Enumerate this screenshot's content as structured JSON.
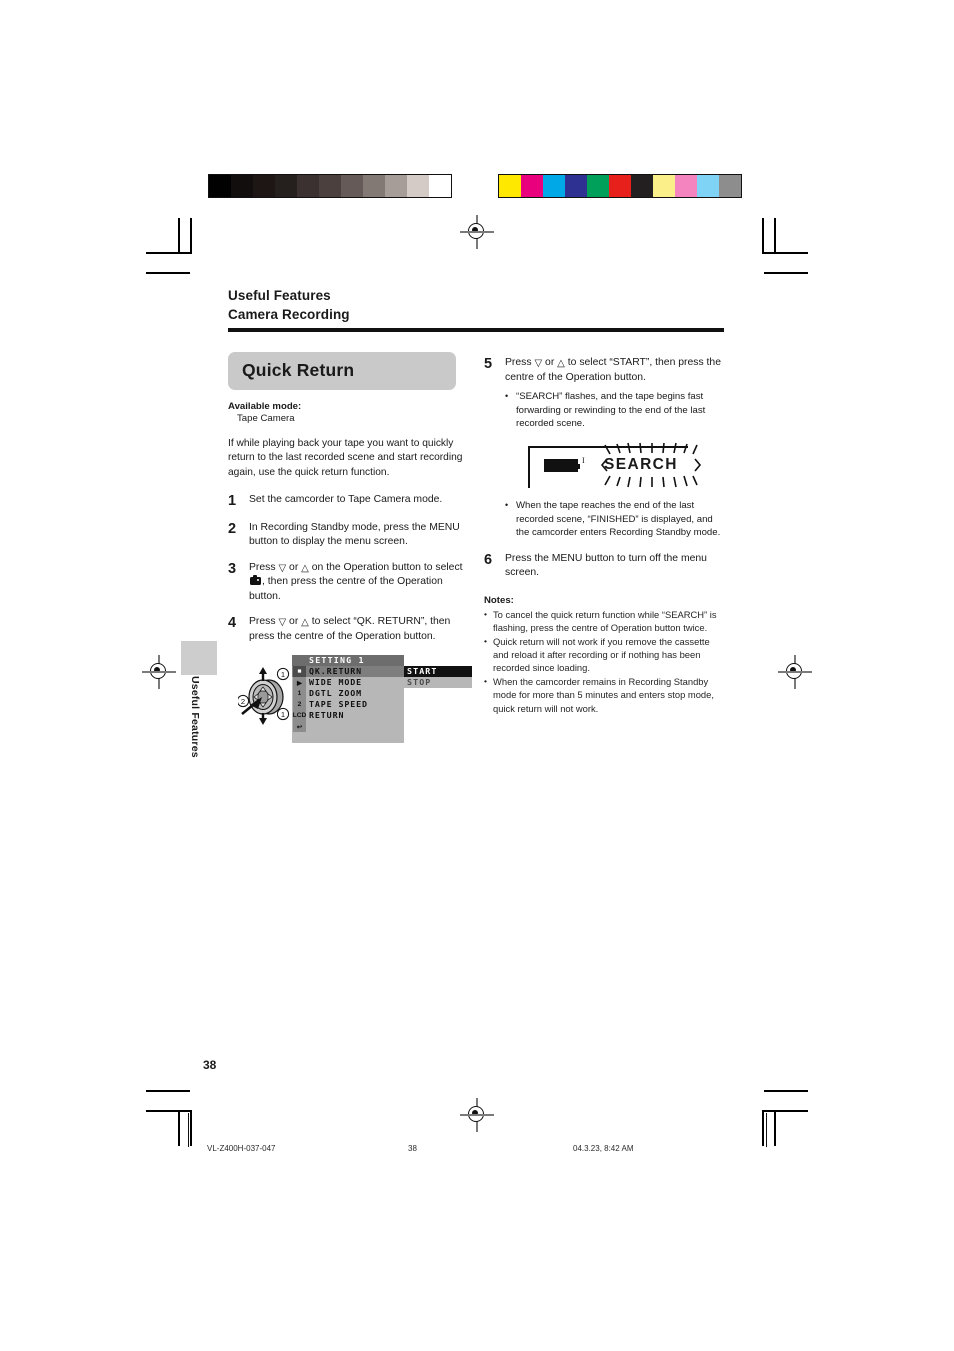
{
  "header": {
    "line1": "Useful Features",
    "line2": "Camera Recording"
  },
  "sidetab": {
    "label": "Useful Features"
  },
  "section": {
    "title": "Quick Return",
    "available_label": "Available mode:",
    "available_value": "Tape Camera",
    "intro": "If while playing back your tape you want to quickly return to the last recorded scene and start recording again, use the quick return function."
  },
  "steps_left": [
    {
      "num": "1",
      "text": "Set the camcorder to Tape Camera mode."
    },
    {
      "num": "2",
      "text": "In Recording Standby mode, press the MENU button to display the menu screen."
    },
    {
      "num": "3",
      "pre": "Press ",
      "t1": "▽",
      "mid1": " or ",
      "t2": "△",
      "mid2": " on the Operation button to select ",
      "post": ", then press the centre of the Operation button."
    },
    {
      "num": "4",
      "pre": "Press ",
      "t1": "▽",
      "mid1": " or ",
      "t2": "△",
      "post": " to select “QK. RETURN”,  then press the centre of the Operation button."
    }
  ],
  "steps_right": [
    {
      "num": "5",
      "pre": "Press ",
      "t1": "▽",
      "mid1": " or ",
      "t2": "△",
      "post": " to select “START”, then press the centre of the Operation button.",
      "bullets": [
        "“SEARCH” flashes, and the tape begins fast forwarding or rewinding to the end of the last recorded scene.",
        "When the tape reaches the end of the last recorded scene, “FINISHED” is displayed, and the camcorder enters Recording Standby mode."
      ]
    },
    {
      "num": "6",
      "text": "Press the MENU button to turn off the menu screen."
    }
  ],
  "search_display": {
    "battery_icon": "battery-icon",
    "battery_mark": "I",
    "word": "SEARCH"
  },
  "menu_figure": {
    "title": "SETTING 1",
    "callout_1": "①",
    "callout_2": "②",
    "icons": [
      {
        "name": "camera-icon",
        "glyph": "■",
        "active": true
      },
      {
        "name": "playback-icon",
        "glyph": "▶",
        "active": false
      },
      {
        "name": "check1-icon",
        "glyph": "1",
        "active": false
      },
      {
        "name": "check2-icon",
        "glyph": "2",
        "active": false
      },
      {
        "name": "lcd-icon",
        "glyph": "LCD",
        "active": false
      },
      {
        "name": "return-icon",
        "glyph": "↩",
        "active": false
      }
    ],
    "rows": [
      {
        "label": "QK.RETURN",
        "selected": true
      },
      {
        "label": "WIDE MODE",
        "selected": false
      },
      {
        "label": "DGTL ZOOM",
        "selected": false
      },
      {
        "label": "TAPE SPEED",
        "selected": false
      },
      {
        "label": "RETURN",
        "selected": false
      }
    ],
    "submenu": [
      {
        "label": "START",
        "highlight": true
      },
      {
        "label": "STOP",
        "highlight": false
      }
    ]
  },
  "notes": {
    "heading": "Notes:",
    "items": [
      "To cancel the quick return function while “SEARCH” is flashing, press the centre of Operation button twice.",
      "Quick return will not work if you remove the cassette and reload it after recording or if nothing has been recorded since loading.",
      "When the camcorder remains in Recording Standby mode for more than 5 minutes and enters stop mode, quick return will not work."
    ]
  },
  "footer": {
    "page_number": "38",
    "file_id": "VL-Z400H-037-047",
    "sheet_number": "38",
    "timestamp": "04.3.23, 8:42 AM"
  },
  "colorbars": {
    "grayscale": [
      "#010101",
      "#120e0e",
      "#1d1615",
      "#25201d",
      "#3a3130",
      "#4b403e",
      "#655a57",
      "#827975",
      "#a69d99",
      "#d4cbc7",
      "#ffffff"
    ],
    "colors": [
      "#ffe800",
      "#e8007d",
      "#00a8e8",
      "#2e3192",
      "#00a05a",
      "#e8201c",
      "#231f20",
      "#fbef8a",
      "#f384c0",
      "#7fd4f5",
      "#8d8d8d"
    ]
  }
}
